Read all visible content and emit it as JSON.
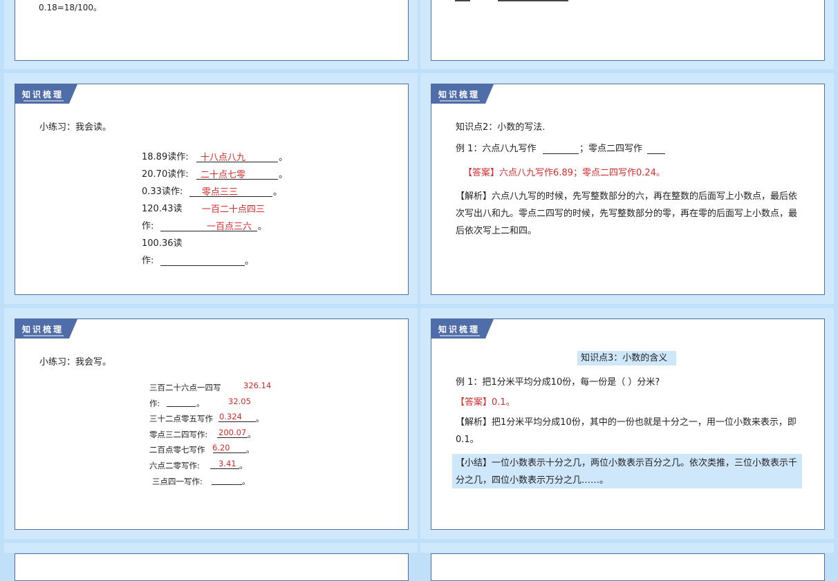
{
  "slide1": {
    "text": "0.18=18/100。"
  },
  "tag_label": "知识梳理",
  "slide3": {
    "title": "小练习：我会读。",
    "lines": [
      "18.89读作:",
      "20.70读作:",
      "0.33读作:",
      "120.43读",
      "作:",
      "100.36读",
      "作:"
    ],
    "answers": [
      "十八点八九",
      "二十点七零",
      "零点三三",
      "一百二十点四三",
      "一百点三六"
    ],
    "period": "。"
  },
  "slide4": {
    "title": "知识点2：小数的写法.",
    "example": "例 1：六点八九写作",
    "example2": "；零点二四写作",
    "answer": "【答案】六点八九写作6.89；零点二四写作0.24。",
    "analysis": "【解析】六点八九写的时候，先写整数部分的六，再在整数的后面写上小数点，最后依次写出八和九。零点二四写的时候，先写整数部分的零，再在零的后面写上小数点，最后依次写上二和四。"
  },
  "slide5": {
    "title": "小练习：我会写。",
    "lines": [
      "三百二十六点一四写",
      "作:",
      "三十二点零五写作",
      "零点三二四写作:",
      "二百点零七写作",
      "六点二零写作:",
      "三点四一写作:"
    ],
    "answers": [
      "326.14",
      "32.05",
      "0.324",
      "200.07",
      "6.20",
      "3.41"
    ],
    "period": "。"
  },
  "slide6": {
    "heading": "知识点3：小数的含义",
    "example": "例 1：把1分米平均分成10份，每一份是（    ）分米?",
    "answer": "【答案】0.1。",
    "analysis": "【解析】把1分米平均分成10份，其中的一份也就是十分之一，用一位小数来表示，即0.1。",
    "summary": "【小结】一位小数表示十分之几，两位小数表示百分之几。依次类推，三位小数表示千分之几，四位小数表示万分之几……。"
  },
  "colors": {
    "accent": "#4f6da8",
    "answer": "#d42a2a",
    "highlight": "#cfe7fa"
  }
}
